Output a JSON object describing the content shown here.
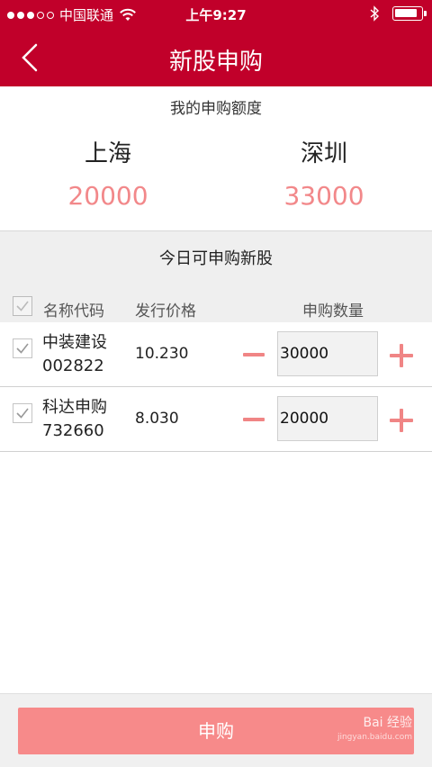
{
  "status_bar": {
    "carrier": "中国联通",
    "time": "上午9:27"
  },
  "nav": {
    "title": "新股申购",
    "back_icon": "chevron-left-icon"
  },
  "quota": {
    "title": "我的申购额度",
    "shanghai_label": "上海",
    "shanghai_amount": "20000",
    "shenzhen_label": "深圳",
    "shenzhen_amount": "33000"
  },
  "today": {
    "title": "今日可申购新股",
    "columns": [
      "名称代码",
      "发行价格",
      "申购数量"
    ]
  },
  "stocks": [
    {
      "name": "中装建设",
      "code": "002822",
      "price": "10.230",
      "qty": "30000",
      "checked": true
    },
    {
      "name": "科达申购",
      "code": "732660",
      "price": "8.030",
      "qty": "20000",
      "checked": true
    }
  ],
  "footer": {
    "submit_label": "申购",
    "watermark": "Bai 经验",
    "watermark_sub": "jingyan.baidu.com"
  },
  "colors": {
    "brand_red": "#c1002a",
    "accent_pink": "#f2888a",
    "button_pink": "#f78a8a"
  }
}
